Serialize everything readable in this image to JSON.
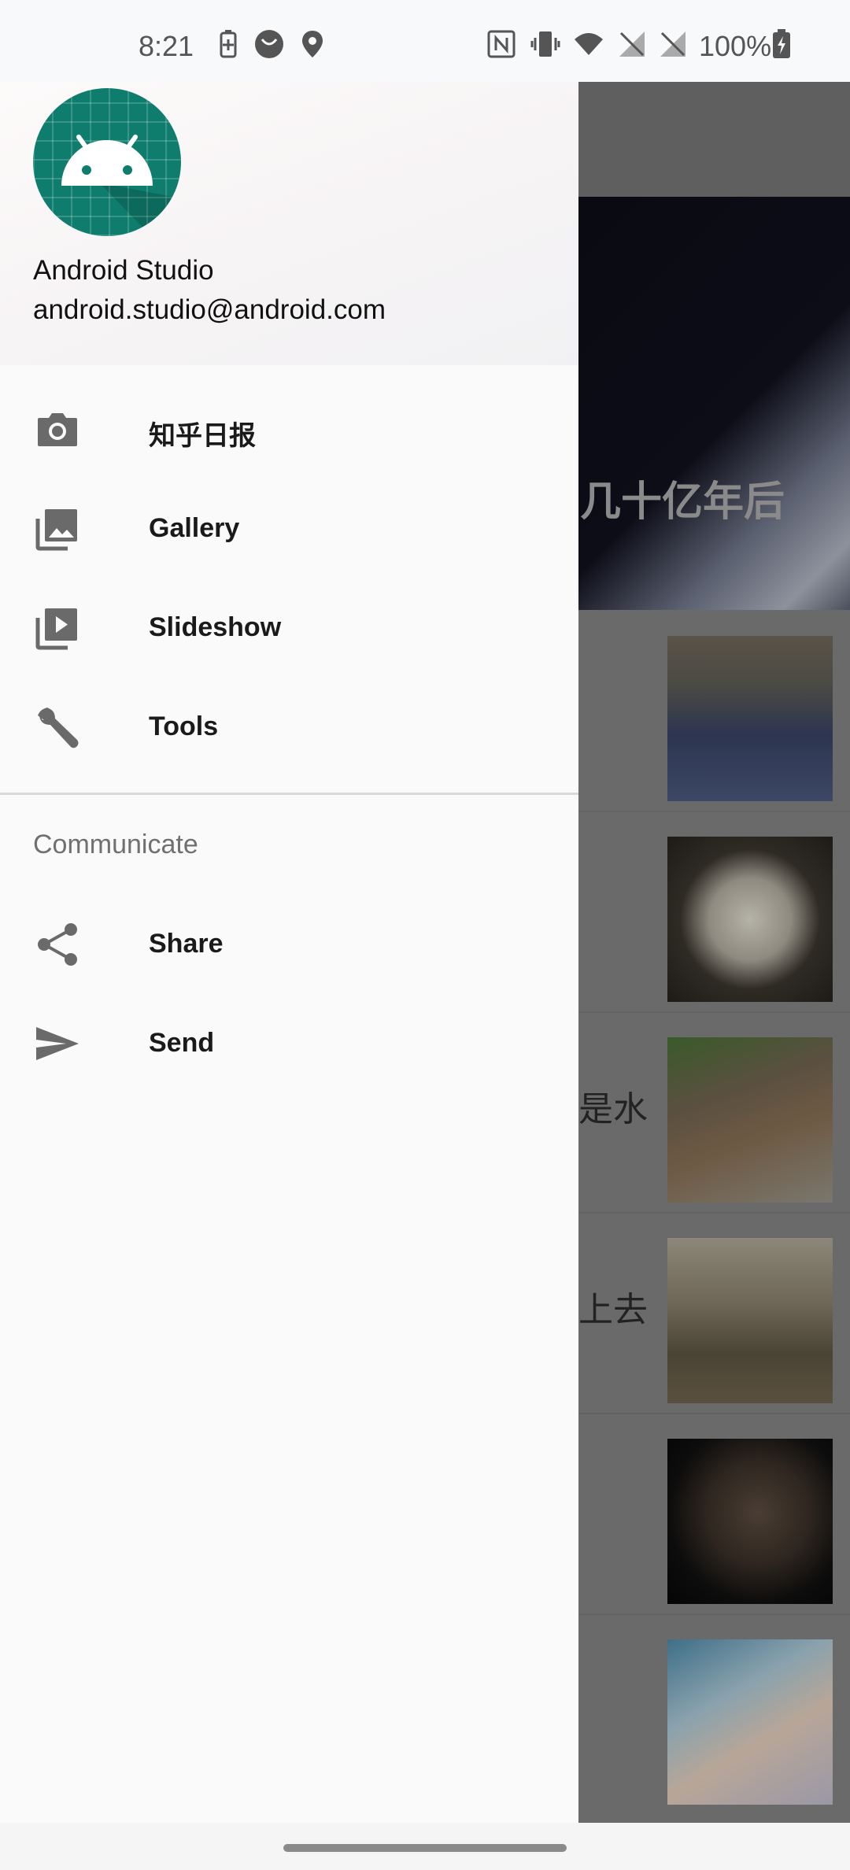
{
  "status_bar": {
    "time": "8:21",
    "battery_percent": "100%",
    "left_icons": [
      "battery-saver-icon",
      "circle-app-icon",
      "location-icon"
    ],
    "right_icons": [
      "nfc-icon",
      "vibrate-icon",
      "wifi-icon",
      "no-signal-icon",
      "no-signal-icon",
      "battery-charging-icon"
    ]
  },
  "drawer": {
    "header": {
      "name": "Android Studio",
      "email": "android.studio@android.com",
      "avatar_color": "#0f7d6e"
    },
    "items": [
      {
        "label": "知乎日报",
        "icon": "camera-icon"
      },
      {
        "label": "Gallery",
        "icon": "gallery-icon"
      },
      {
        "label": "Slideshow",
        "icon": "slideshow-icon"
      },
      {
        "label": "Tools",
        "icon": "wrench-icon"
      }
    ],
    "section_title": "Communicate",
    "section_items": [
      {
        "label": "Share",
        "icon": "share-icon"
      },
      {
        "label": "Send",
        "icon": "send-icon"
      }
    ]
  },
  "background": {
    "banner_text": "几十亿年后",
    "rows": [
      {
        "text": ""
      },
      {
        "text": ""
      },
      {
        "text": "是水"
      },
      {
        "text": "上去"
      },
      {
        "text": ""
      },
      {
        "text": ""
      }
    ]
  }
}
